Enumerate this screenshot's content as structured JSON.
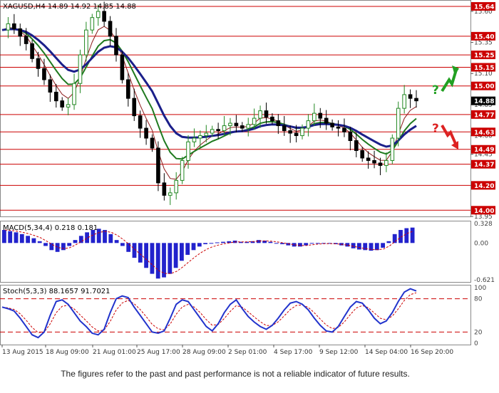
{
  "chart_data": [
    {
      "type": "candlestick",
      "title": "XAGUSD,H4  14.89 14.92 14.85 14.88",
      "symbol": "XAGUSD",
      "timeframe": "H4",
      "ohlc_last": {
        "open": 14.89,
        "high": 14.92,
        "low": 14.85,
        "close": 14.88
      },
      "ylim": [
        13.95,
        15.68
      ],
      "y_ticks": [
        "15.60",
        "15.35",
        "15.10",
        "14.85",
        "14.60",
        "14.45",
        "14.20",
        "13.95"
      ],
      "price_tag": "14.88",
      "levels": [
        {
          "value": 15.64,
          "label": "15.64"
        },
        {
          "value": 15.4,
          "label": "15.40"
        },
        {
          "value": 15.25,
          "label": "15.25"
        },
        {
          "value": 15.15,
          "label": "15.15"
        },
        {
          "value": 15.0,
          "label": "15.00"
        },
        {
          "value": 14.77,
          "label": "14.77"
        },
        {
          "value": 14.63,
          "label": "14.63"
        },
        {
          "value": 14.49,
          "label": "14.49"
        },
        {
          "value": 14.37,
          "label": "14.37"
        },
        {
          "value": 14.2,
          "label": "14.20"
        },
        {
          "value": 14.0,
          "label": "14.00"
        }
      ],
      "close_path": [
        15.45,
        15.5,
        15.46,
        15.4,
        15.34,
        15.22,
        15.14,
        15.05,
        14.95,
        14.88,
        14.83,
        14.85,
        15.02,
        15.25,
        15.45,
        15.55,
        15.6,
        15.52,
        15.4,
        15.25,
        15.05,
        14.9,
        14.76,
        14.66,
        14.58,
        14.5,
        14.22,
        14.12,
        14.14,
        14.24,
        14.4,
        14.55,
        14.58,
        14.6,
        14.62,
        14.65,
        14.64,
        14.68,
        14.7,
        14.68,
        14.66,
        14.69,
        14.74,
        14.8,
        14.75,
        14.72,
        14.68,
        14.64,
        14.62,
        14.6,
        14.66,
        14.72,
        14.78,
        14.74,
        14.7,
        14.67,
        14.66,
        14.63,
        14.56,
        14.48,
        14.42,
        14.4,
        14.38,
        14.36,
        14.4,
        14.58,
        14.82,
        14.93,
        14.9,
        14.88
      ],
      "signals": [
        {
          "symbol": "?",
          "direction": "up",
          "color": "#22a022"
        },
        {
          "symbol": "?",
          "direction": "down",
          "color": "#dd2222"
        }
      ]
    },
    {
      "type": "histogram",
      "title": "MACD(5,34,4) 0.218 0.181",
      "ylim": [
        -0.621,
        0.328
      ],
      "y_ticks": [
        "0.328",
        "0.00",
        "-0.621"
      ],
      "values": [
        0.22,
        0.2,
        0.18,
        0.15,
        0.12,
        0.08,
        0.03,
        -0.05,
        -0.12,
        -0.15,
        -0.12,
        -0.05,
        0.05,
        0.12,
        0.18,
        0.22,
        0.24,
        0.22,
        0.15,
        0.05,
        -0.05,
        -0.15,
        -0.25,
        -0.33,
        -0.42,
        -0.52,
        -0.6,
        -0.58,
        -0.52,
        -0.42,
        -0.3,
        -0.2,
        -0.12,
        -0.06,
        -0.02,
        0.0,
        0.01,
        0.02,
        0.03,
        0.04,
        0.02,
        0.02,
        0.03,
        0.05,
        0.04,
        0.02,
        0.0,
        -0.02,
        -0.04,
        -0.06,
        -0.06,
        -0.04,
        -0.01,
        0.0,
        0.0,
        -0.01,
        -0.02,
        -0.04,
        -0.06,
        -0.09,
        -0.11,
        -0.12,
        -0.13,
        -0.12,
        -0.08,
        0.03,
        0.15,
        0.22,
        0.25,
        0.26
      ]
    },
    {
      "type": "line",
      "title": "Stoch(5,3,3) 88.1657 91.7021",
      "ylim": [
        0,
        100
      ],
      "y_ticks": [
        "100",
        "80",
        "20",
        "0"
      ],
      "levels": [
        80,
        20
      ],
      "values": [
        65,
        62,
        58,
        45,
        30,
        15,
        10,
        20,
        50,
        75,
        78,
        70,
        55,
        40,
        30,
        18,
        15,
        25,
        55,
        80,
        85,
        82,
        65,
        50,
        35,
        20,
        18,
        22,
        45,
        70,
        78,
        75,
        60,
        45,
        30,
        22,
        35,
        55,
        70,
        78,
        62,
        48,
        38,
        30,
        25,
        32,
        45,
        60,
        72,
        75,
        70,
        60,
        45,
        32,
        22,
        20,
        30,
        48,
        65,
        75,
        72,
        60,
        45,
        35,
        40,
        55,
        75,
        92,
        98,
        94
      ]
    }
  ],
  "x_labels": [
    "13 Aug 2015",
    "18 Aug 09:00",
    "21 Aug 01:00",
    "25 Aug 17:00",
    "28 Aug 09:00",
    "2 Sep 01:00",
    "4 Sep 17:00",
    "9 Sep 12:00",
    "14 Sep 04:00",
    "16 Sep 20:00"
  ],
  "colors": {
    "bull_candle": "#228822",
    "bear_candle": "#000000",
    "ma_fast": "#8b1a1a",
    "ma_mid": "#1f7a1f",
    "ma_slow": "#1b1f8a",
    "level": "#cc0000",
    "histogram": "#2222cc",
    "signal_line": "#cc0000",
    "stoch_main": "#2233cc"
  },
  "disclaimer": "The figures refer to the past and past performance is not a reliable indicator of future results."
}
